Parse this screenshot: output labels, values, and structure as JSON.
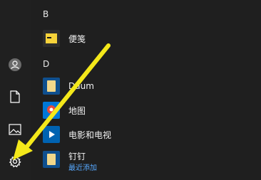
{
  "sections": [
    {
      "letter": "B",
      "apps": [
        {
          "label": "便笺"
        }
      ]
    },
    {
      "letter": "D",
      "apps": [
        {
          "label": "Daum"
        },
        {
          "label": "地图"
        },
        {
          "label": "电影和电视"
        },
        {
          "label": "钉钉",
          "sublabel": "最近添加"
        }
      ]
    }
  ],
  "rail": {
    "icons": [
      "user-icon",
      "document-icon",
      "pictures-icon",
      "settings-gear-icon"
    ]
  },
  "annotation": {
    "color": "#f4e81a",
    "points_to": "settings-gear-icon"
  }
}
